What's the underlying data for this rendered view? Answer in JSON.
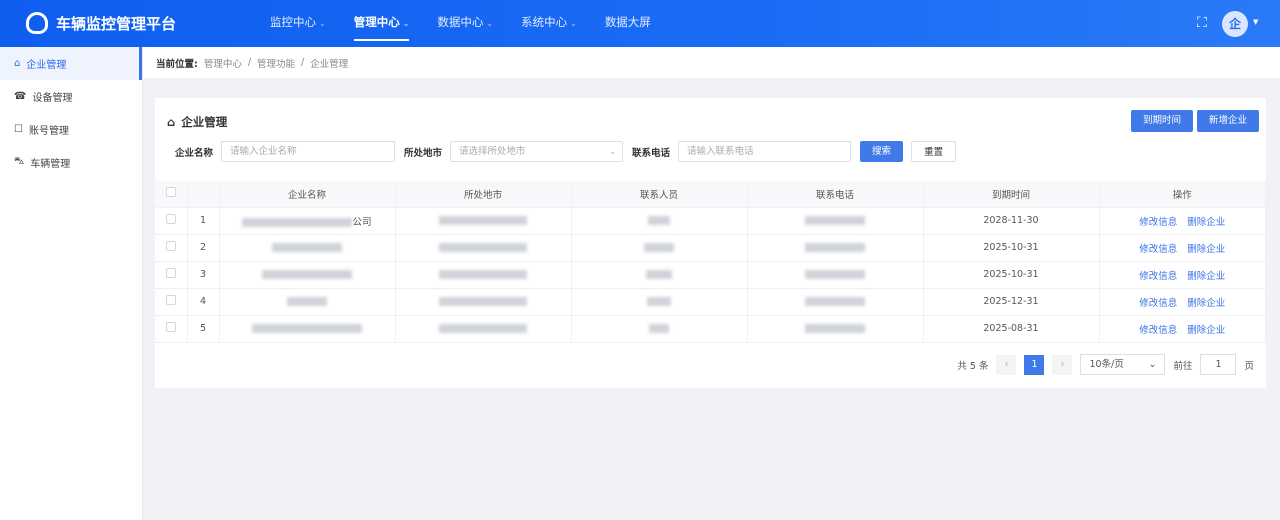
{
  "header": {
    "title": "车辆监控管理平台",
    "nav": [
      {
        "label": "监控中心",
        "chevron": true
      },
      {
        "label": "管理中心",
        "chevron": true,
        "active": true
      },
      {
        "label": "数据中心",
        "chevron": true
      },
      {
        "label": "系统中心",
        "chevron": true
      },
      {
        "label": "数据大屏",
        "chevron": false
      }
    ],
    "avatar_glyph": "企"
  },
  "sidebar": {
    "items": [
      {
        "label": "企业管理",
        "icon": "building-icon",
        "glyph": "⌂",
        "active": true
      },
      {
        "label": "设备管理",
        "icon": "device-icon",
        "glyph": "☎"
      },
      {
        "label": "账号管理",
        "icon": "account-icon",
        "glyph": "☐"
      },
      {
        "label": "车辆管理",
        "icon": "car-icon",
        "glyph": "⛍"
      }
    ]
  },
  "breadcrumb": {
    "prefix": "当前位置:",
    "items": [
      "管理中心",
      "管理功能",
      "企业管理"
    ],
    "sep": "/"
  },
  "card": {
    "title": "企业管理",
    "buttons": {
      "expire": "到期时间",
      "add": "新增企业"
    }
  },
  "filters": {
    "name_label": "企业名称",
    "name_placeholder": "请输入企业名称",
    "city_label": "所处地市",
    "city_placeholder": "请选择所处地市",
    "phone_label": "联系电话",
    "phone_placeholder": "请输入联系电话",
    "search": "搜索",
    "reset": "重置"
  },
  "table": {
    "columns": [
      "企业名称",
      "所处地市",
      "联系人员",
      "联系电话",
      "到期时间",
      "操作"
    ],
    "rows": [
      {
        "index": "1",
        "name_suffix": "公司",
        "expire": "2028-11-30"
      },
      {
        "index": "2",
        "name_suffix": "",
        "expire": "2025-10-31"
      },
      {
        "index": "3",
        "name_suffix": "",
        "expire": "2025-10-31"
      },
      {
        "index": "4",
        "name_suffix": "",
        "expire": "2025-12-31"
      },
      {
        "index": "5",
        "name_suffix": "",
        "expire": "2025-08-31"
      }
    ],
    "actions": {
      "edit": "修改信息",
      "delete": "删除企业"
    }
  },
  "pagination": {
    "total": "共 5 条",
    "current": "1",
    "page_size": "10条/页",
    "goto_label": "前往",
    "goto_value": "1",
    "page_unit": "页"
  },
  "colors": {
    "primary": "#3f7ae8",
    "header": "#1565f0"
  }
}
